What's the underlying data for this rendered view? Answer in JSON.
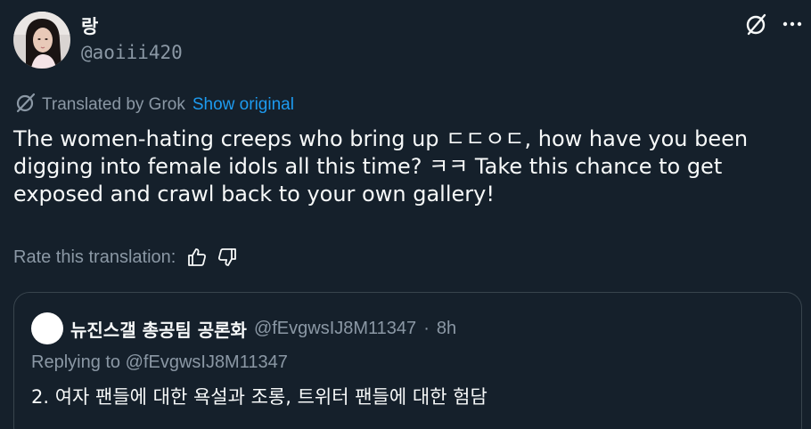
{
  "author": {
    "display_name": "랑",
    "handle": "@aoiii420",
    "avatar_icon": "profile-photo"
  },
  "header_actions": {
    "grok_icon": "grok-slash-circle-icon",
    "more_icon": "more-dots-icon"
  },
  "translation": {
    "label": "Translated by Grok",
    "show_original": "Show original"
  },
  "body": {
    "text": "The women-hating creeps who bring up ㄷㄷㅇㄷ, how have you been digging into female idols all this time? ㅋㅋ Take this chance to get exposed and crawl back to your own gallery!"
  },
  "rate": {
    "label": "Rate this translation:",
    "thumbs_up_icon": "thumbs-up-icon",
    "thumbs_down_icon": "thumbs-down-icon"
  },
  "quote": {
    "display_name": "뉴진스갤 총공팀 공론화",
    "handle": "@fEvgwsIJ8M11347",
    "separator": "·",
    "time": "8h",
    "replying_to": "Replying to @fEvgwsIJ8M11347",
    "text": "2. 여자 팬들에 대한 욕설과 조롱, 트위터 팬들에 대한 험담"
  },
  "colors": {
    "background": "#15202b",
    "primary_text": "#f7f9f9",
    "secondary_text": "#8b98a5",
    "link": "#1d9bf0",
    "border": "#38444d"
  }
}
